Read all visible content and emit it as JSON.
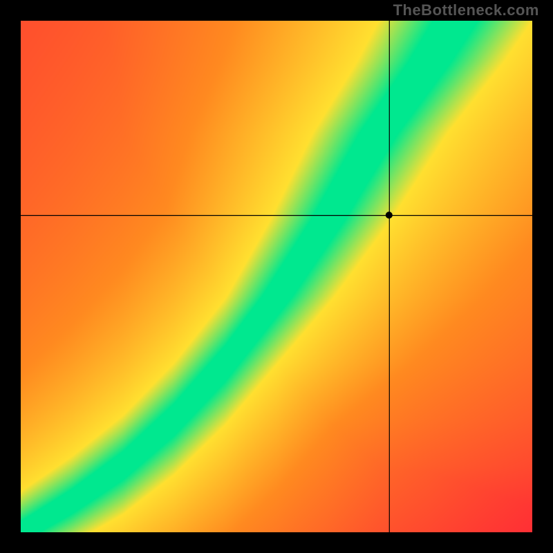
{
  "watermark": "TheBottleneck.com",
  "chart_data": {
    "type": "heatmap",
    "title": "",
    "xlabel": "",
    "ylabel": "",
    "xlim": [
      0,
      1
    ],
    "ylim": [
      0,
      1
    ],
    "crosshair": {
      "x": 0.72,
      "y": 0.62
    },
    "marker": {
      "x": 0.72,
      "y": 0.62
    },
    "optimal_curve": {
      "description": "Green optimal band center as (x, y) normalized points",
      "points": [
        [
          0.0,
          0.0
        ],
        [
          0.1,
          0.06
        ],
        [
          0.2,
          0.13
        ],
        [
          0.3,
          0.22
        ],
        [
          0.4,
          0.33
        ],
        [
          0.5,
          0.46
        ],
        [
          0.6,
          0.61
        ],
        [
          0.7,
          0.78
        ],
        [
          0.8,
          0.92
        ],
        [
          0.85,
          1.0
        ]
      ]
    },
    "color_stops": {
      "green": "#00e88f",
      "yellow": "#ffe030",
      "orange": "#ff8a20",
      "red": "#ff1a3a"
    },
    "grid": false,
    "legend": null
  }
}
